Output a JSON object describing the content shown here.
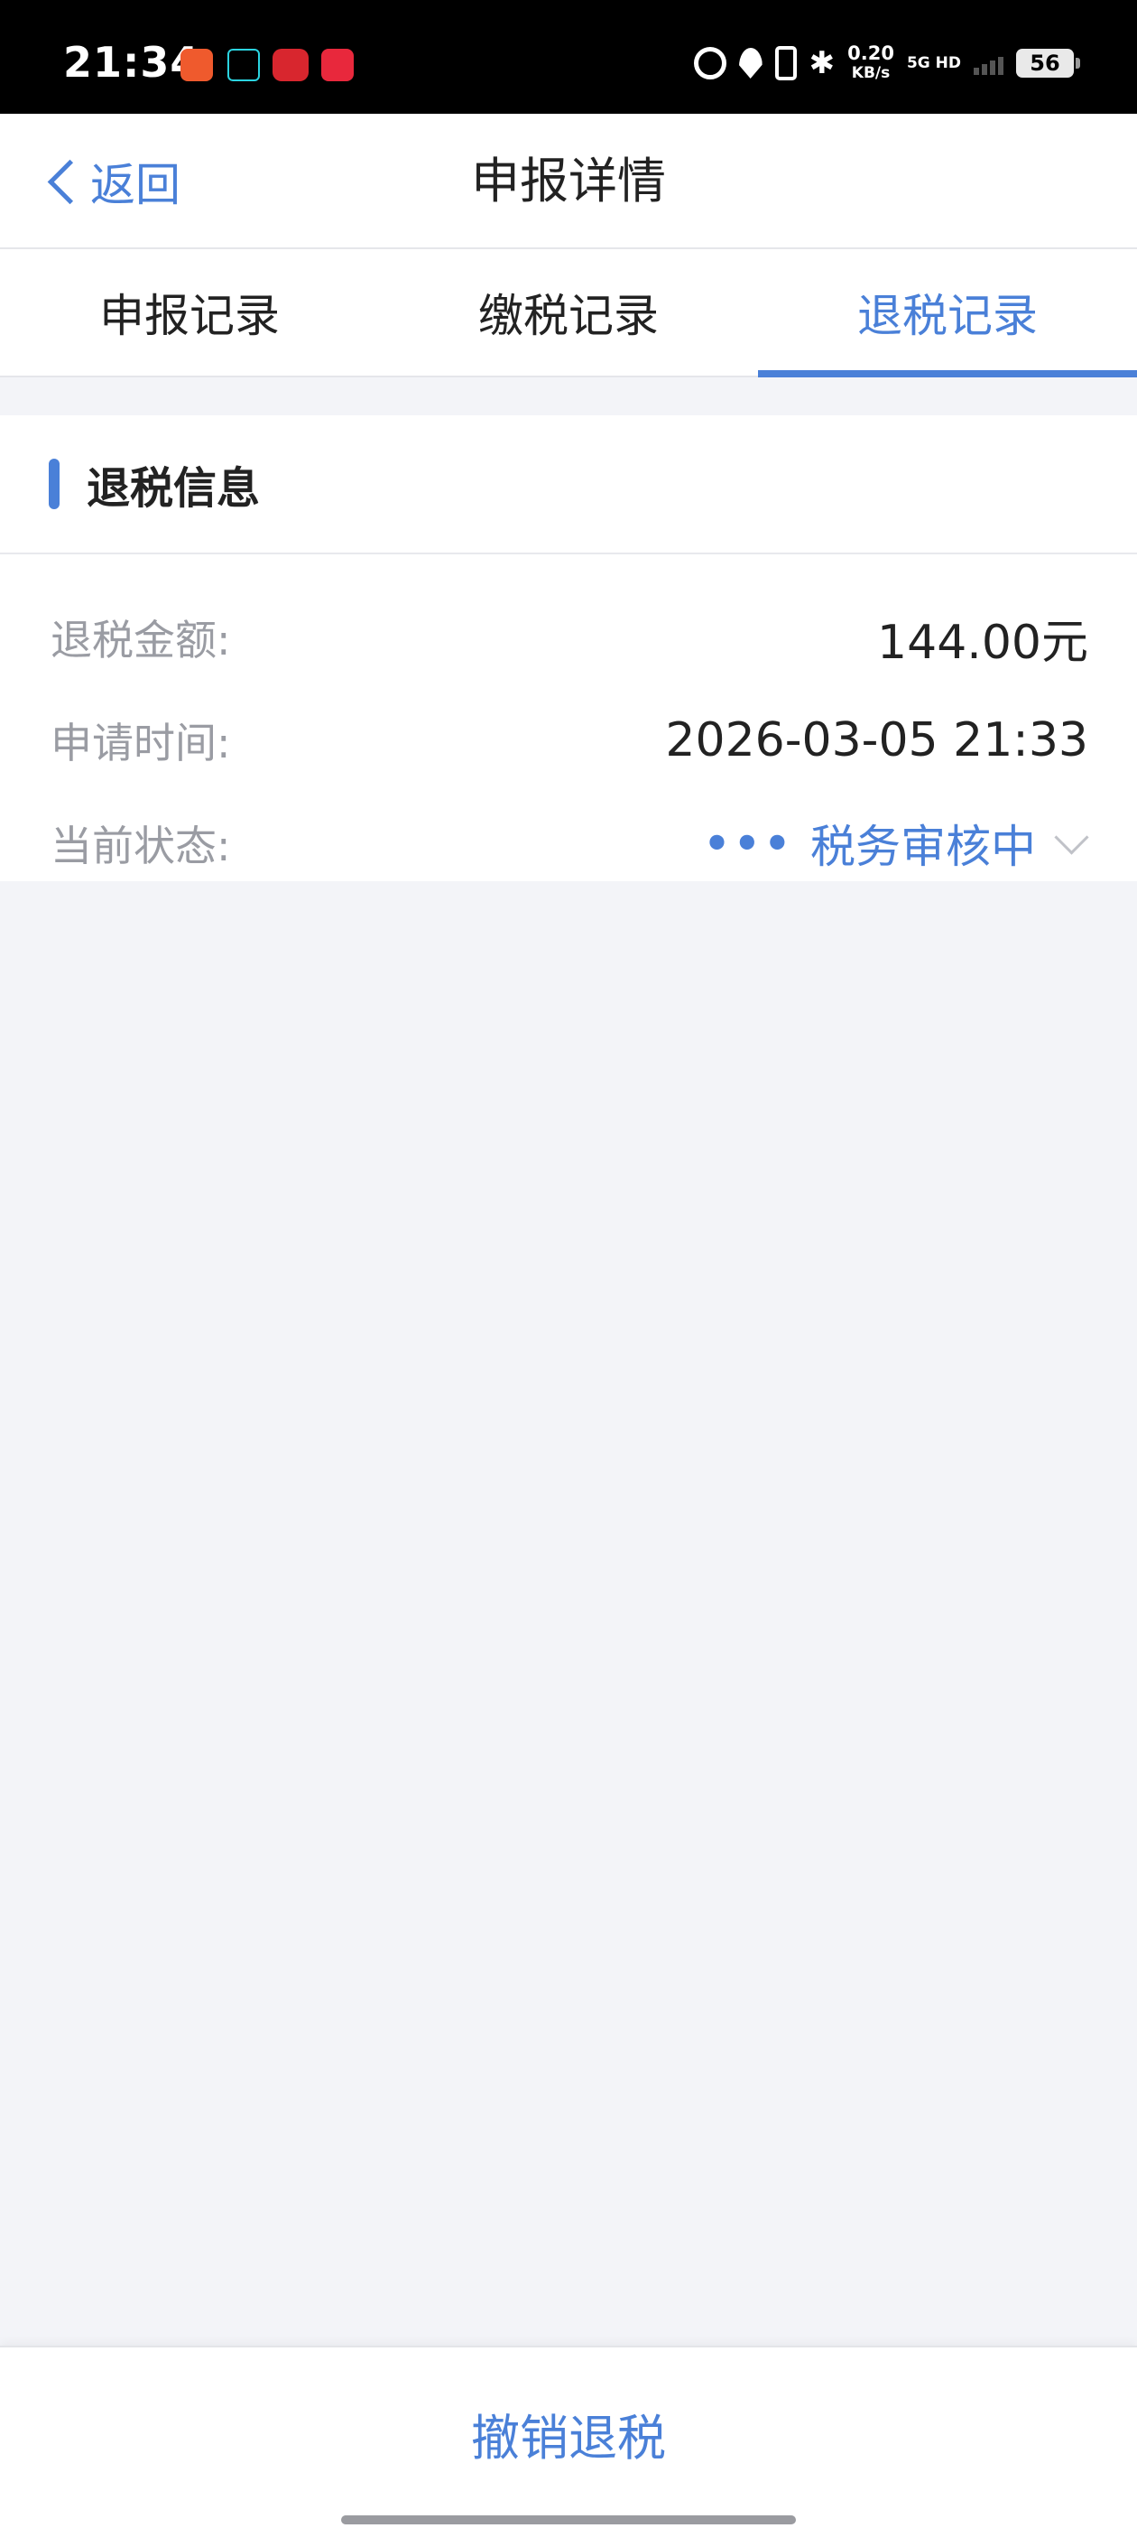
{
  "status_bar": {
    "time": "21:34",
    "speed_value": "0.20",
    "speed_unit": "KB/s",
    "network": "5G HD",
    "battery": "56"
  },
  "header": {
    "back_label": "返回",
    "title": "申报详情"
  },
  "tabs": [
    {
      "label": "申报记录",
      "active": false
    },
    {
      "label": "缴税记录",
      "active": false
    },
    {
      "label": "退税记录",
      "active": true
    }
  ],
  "refund_info": {
    "section_title": "退税信息",
    "rows": [
      {
        "label": "退税金额:",
        "value": "144.00元"
      },
      {
        "label": "申请时间:",
        "value": "2026-03-05 21:33"
      },
      {
        "label": "当前状态:",
        "value": "税务审核中"
      }
    ]
  },
  "footer": {
    "revoke_label": "撤销退税"
  },
  "colors": {
    "accent": "#4a80d8",
    "background": "#f3f4f8",
    "label_gray": "#9a9ca3"
  }
}
